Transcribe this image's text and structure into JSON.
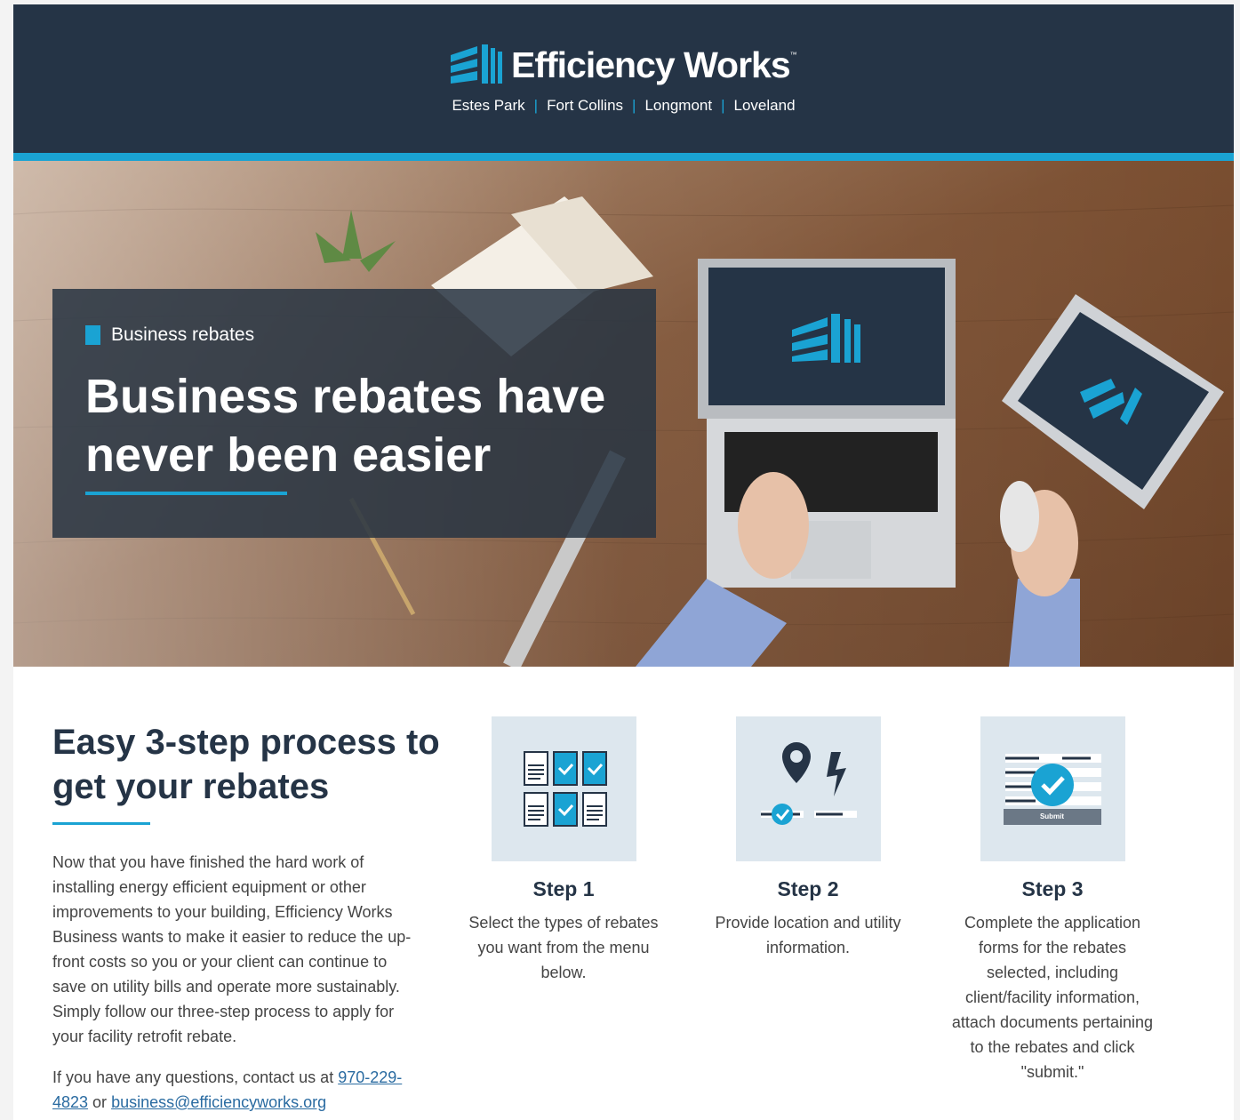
{
  "header": {
    "brand": "Efficiency Works",
    "tm": "™",
    "cities": [
      "Estes Park",
      "Fort Collins",
      "Longmont",
      "Loveland"
    ]
  },
  "hero": {
    "kicker": "Business rebates",
    "title": "Business rebates have never been easier"
  },
  "intro": {
    "title": "Easy 3-step process to get your rebates",
    "text": "Now that you have finished the hard work of installing energy efficient equipment or other improvements to your building, Efficiency Works Business wants to make it easier to reduce the up-front costs so you or your client can continue to save on utility bills and operate more sustainably. Simply follow our three-step process to apply for your facility retrofit rebate.",
    "contact_prefix": "If you have any questions, contact us at ",
    "phone": "970-229-4823",
    "contact_mid": " or ",
    "email": "business@efficiencyworks.org"
  },
  "steps": [
    {
      "label": "Step 1",
      "desc": "Select the types of rebates you want from the menu below.",
      "icon": "checklist-grid-icon"
    },
    {
      "label": "Step 2",
      "desc": "Provide location and utility information.",
      "icon": "location-utility-icon"
    },
    {
      "label": "Step 3",
      "desc": "Complete the application forms for the rebates selected, including client/facility information, attach documents pertaining to the rebates and click \"submit.\"",
      "icon": "submit-form-icon",
      "button_text": "Submit"
    }
  ],
  "colors": {
    "navy": "#253446",
    "accent": "#1aa3d3"
  }
}
